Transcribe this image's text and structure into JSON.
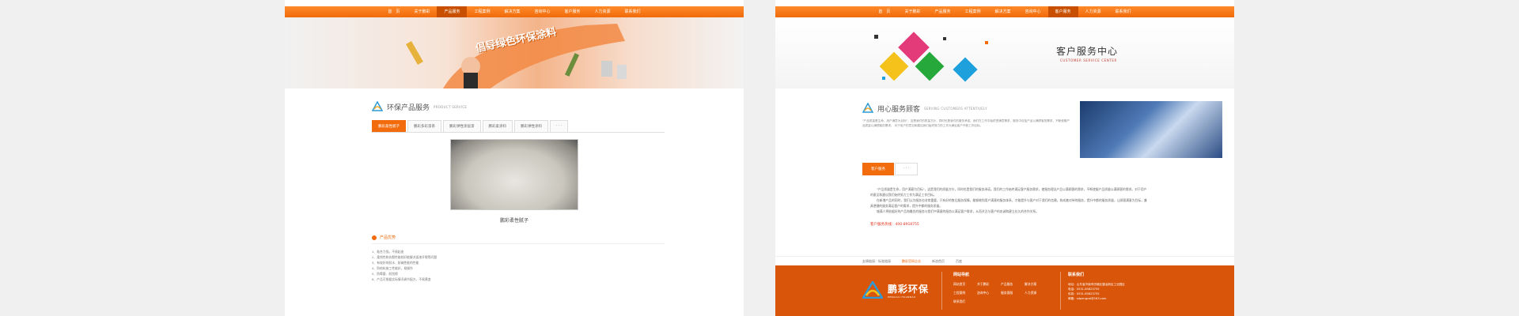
{
  "left": {
    "nav": [
      "首　页",
      "关于鹏彩",
      "产品服务",
      "工程案例",
      "解决方案",
      "咨询中心",
      "客户服务",
      "人力资源",
      "联系我们"
    ],
    "nav_active": 2,
    "banner_slogan": "倡导绿色环保涂料",
    "section": {
      "title": "环保产品服务",
      "subtitle": "PRODUCT SERVICE"
    },
    "tabs": [
      "鹏彩柔性腻子",
      "鹏彩多彩漆系",
      "鹏彩弹性涂层漆",
      "鹏彩柔涂料",
      "鹏彩弹性涂料",
      "· · ·"
    ],
    "tab_active": 0,
    "product_caption": "鹏彩柔性腻子",
    "advantage_title": "产品优势",
    "advantages": [
      "1、粘合力强，不易起皮",
      "2、柔韧性和抗裂性能较好能解决面漆开裂等问题",
      "3、有较好的耐水、耐碱性能的性能",
      "4、防结料施工性能好，易操作",
      "5、防霉菌、耐刮擦",
      "6、产品可根据实际情况调节配方，不易黄变"
    ]
  },
  "right": {
    "nav": [
      "首　页",
      "关于鹏彩",
      "产品服务",
      "工程案例",
      "解决方案",
      "咨询中心",
      "客户服务",
      "人力资源",
      "联系我们"
    ],
    "nav_active": 6,
    "banner_title": "客户服务中心",
    "banner_subtitle": "CUSTOMER SERVICE CENTER",
    "icon_labels": [
      "",
      "",
      "",
      ""
    ],
    "section": {
      "title": "用心服务顾客",
      "subtitle": "SERVING CUSTOMERS ATTENTIVELY"
    },
    "intro": "\"产品质量是生命，用户满意为目标\"，这是我们的质量方针，同时也是我们的服务承诺。我们在工作中始终把满意需求，服务中包括产品以满顾客的需求，不断使服产品质量以满顾客的需求。 对于用户的意见和建议我们始终努力的工作为满足客户不断工作目标。",
    "buttons": [
      "客户服务",
      "· · ·"
    ],
    "body": [
      "\"产品质量是生命，用户满意为目标\"，这是我们的质量方针，同时也是我们的服务承诺。我们的工作始终满足客户服务需求，使服务理念产品以满顾客的需求，不断使服产品质量以满顾客的需求。对于用户的意见和建议我们始终努力工作为满足工作目标。",
      "在新增产品的同时，我们认为服务也非常重要，只有好的售后服务保障，能够做到用户满意的服务体系，才能提升与客户对于我们的信赖，和成套对待的服务，提升中都的服务质量，让顾客满意为目标，兼具便捷的服务满足客户的需求，提升中都的服务质量。",
      "城满人将依据好的产品和最优的服务与我们中满意的服务以满足客户需求，从而关注与客户的忠诚和建立长久的合作关系。"
    ],
    "hotline": "客户服务热线：400-8918755",
    "crumbs": [
      "友情链接：标准链接",
      "鹏彩官网企业",
      "新浪首页",
      "百度"
    ],
    "footer": {
      "brand": "鹏彩环保",
      "brand_en": "PENGCAI HUANBAO",
      "nav_title": "网站导航",
      "nav_items": [
        "网站首页",
        "关于鹏彩",
        "产品服务",
        "解决方案",
        "工程案例",
        "咨询中心",
        "服务客服",
        "人力资源",
        "联系我们"
      ],
      "contact_title": "联系我们",
      "contact_lines": [
        "地址：山东省济南市历城区唐冶新区工业园区",
        "电话：0531-85823755",
        "传真：0531-85823755",
        "邮箱：sdpengcai@163.com"
      ]
    }
  }
}
